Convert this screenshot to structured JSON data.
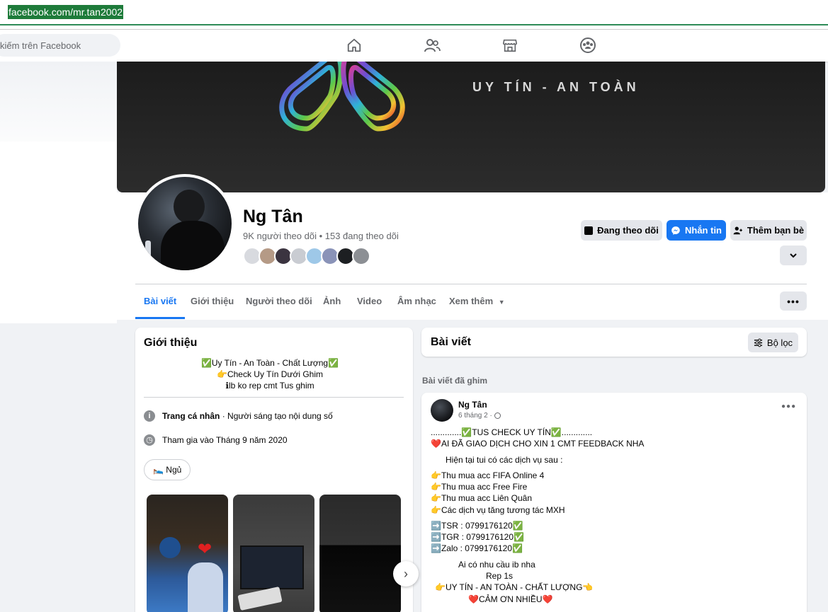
{
  "browser": {
    "url": "facebook.com/mr.tan2002"
  },
  "topnav": {
    "search_placeholder": "kiếm trên Facebook",
    "icons": [
      "home-icon",
      "friends-icon",
      "marketplace-icon",
      "groups-icon"
    ]
  },
  "cover": {
    "slogan": "UY TÍN - AN TOÀN"
  },
  "profile": {
    "name": "Ng Tân",
    "follow_stats": "9K người theo dõi • 153 đang theo dõi"
  },
  "actions": {
    "following": "Đang theo dõi",
    "message": "Nhắn tin",
    "add_friend": "Thêm bạn bè"
  },
  "tabs": [
    {
      "label": "Bài viết"
    },
    {
      "label": "Giới thiệu"
    },
    {
      "label": "Người theo dõi"
    },
    {
      "label": "Ảnh"
    },
    {
      "label": "Video"
    },
    {
      "label": "Âm nhạc"
    },
    {
      "label": "Xem thêm"
    }
  ],
  "intro": {
    "title": "Giới thiệu",
    "bio": [
      "✅Uy Tín - An Toàn - Chất Lượng✅",
      "👉Check Uy Tín Dưới Ghim",
      "ℹlb ko rep cmt Tus ghim"
    ],
    "profile_label": "Trang cá nhân",
    "profile_desc": " · Người sáng tạo nội dung số",
    "joined": "Tham gia vào Tháng 9 năm 2020",
    "status_chip": "🛌 Ngủ"
  },
  "posts": {
    "title": "Bài viết",
    "filter": "Bộ lọc",
    "pinned_label": "Bài viết đã ghim",
    "post": {
      "author": "Ng Tân",
      "time": "6 tháng 2 ·",
      "lines": [
        ".............✅TUS CHECK UY TÍN✅.............",
        "❤️AI ĐÃ GIAO DỊCH CHO XIN 1 CMT FEEDBACK NHA",
        "Hiện tại tui có các dịch vụ sau :",
        "👉Thu mua acc FIFA Online 4",
        "👉Thu mua acc Free Fire",
        "👉Thu mua acc Liên Quân",
        "👉Các dịch vụ tăng tương tác MXH",
        "➡️TSR : 0799176120✅",
        "➡️TGR : 0799176120✅",
        "➡️Zalo : 0799176120✅",
        "Ai có nhu cầu ib nha",
        "Rep 1s",
        "👉UY TÍN - AN TOÀN - CHẤT LƯỢNG👈",
        "❤️CẢM ƠN NHIỀU❤️"
      ]
    }
  },
  "colors": {
    "brand_blue": "#1877f2",
    "page_bg": "#f0f2f5",
    "url_highlight": "#1e7b3a"
  }
}
